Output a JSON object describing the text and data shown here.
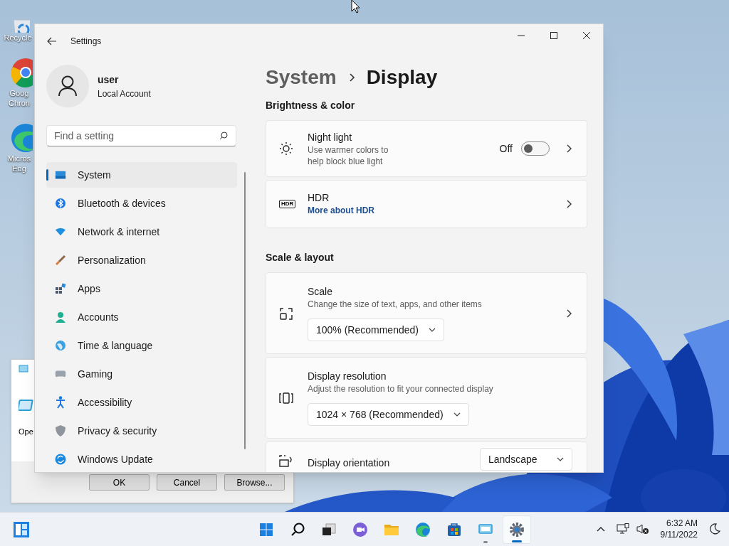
{
  "desktop": {
    "icons": [
      {
        "lines": [
          "Recycle"
        ]
      },
      {
        "lines": [
          "Goog",
          "Chron"
        ]
      },
      {
        "lines": [
          "Micros",
          "Edg"
        ]
      }
    ]
  },
  "run_dialog": {
    "text": "Ope",
    "buttons": [
      "OK",
      "Cancel",
      "Browse..."
    ]
  },
  "settings": {
    "title": "Settings",
    "user": {
      "name": "user",
      "account": "Local Account"
    },
    "search": {
      "placeholder": "Find a setting"
    },
    "nav": [
      {
        "label": "System",
        "selected": true
      },
      {
        "label": "Bluetooth & devices",
        "selected": false
      },
      {
        "label": "Network & internet",
        "selected": false
      },
      {
        "label": "Personalization",
        "selected": false
      },
      {
        "label": "Apps",
        "selected": false
      },
      {
        "label": "Accounts",
        "selected": false
      },
      {
        "label": "Time & language",
        "selected": false
      },
      {
        "label": "Gaming",
        "selected": false
      },
      {
        "label": "Accessibility",
        "selected": false
      },
      {
        "label": "Privacy & security",
        "selected": false
      },
      {
        "label": "Windows Update",
        "selected": false
      }
    ],
    "breadcrumb": {
      "parent": "System",
      "current": "Display"
    },
    "sections": [
      {
        "heading": "Brightness & color",
        "cards": [
          {
            "kind": "toggle",
            "title": "Night light",
            "subtitle": "Use warmer colors to help block blue light",
            "state_label": "Off",
            "on": false
          },
          {
            "kind": "link",
            "icon_text": "HDR",
            "title": "HDR",
            "link": "More about HDR"
          }
        ]
      },
      {
        "heading": "Scale & layout",
        "cards": [
          {
            "kind": "dropdown",
            "title": "Scale",
            "subtitle": "Change the size of text, apps, and other items",
            "value": "100% (Recommended)",
            "chevron": true
          },
          {
            "kind": "dropdown",
            "title": "Display resolution",
            "subtitle": "Adjust the resolution to fit your connected display",
            "value": "1024 × 768 (Recommended)",
            "chevron": false
          },
          {
            "kind": "inline_dropdown",
            "title": "Display orientation",
            "value": "Landscape"
          }
        ]
      }
    ]
  },
  "taskbar": {
    "apps": [
      {
        "running": false,
        "selected": false
      },
      {
        "running": false,
        "selected": false
      },
      {
        "running": false,
        "selected": false
      },
      {
        "running": false,
        "selected": false
      },
      {
        "running": false,
        "selected": false
      },
      {
        "running": false,
        "selected": false
      },
      {
        "running": false,
        "selected": false
      },
      {
        "running": true,
        "selected": false
      },
      {
        "running": true,
        "selected": true
      }
    ],
    "time": "6:32 AM",
    "date": "9/11/2022"
  }
}
